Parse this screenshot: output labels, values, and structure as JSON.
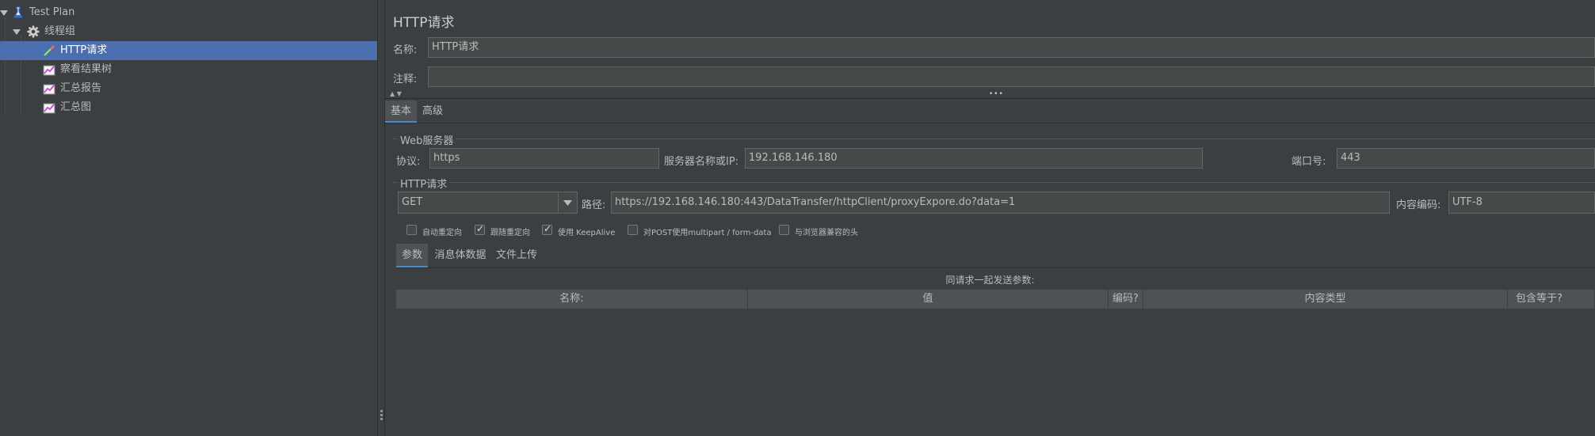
{
  "tree": {
    "items": [
      {
        "label": "Test Plan",
        "icon": "test-plan-icon"
      },
      {
        "label": "线程组",
        "icon": "gear-icon"
      },
      {
        "label": "HTTP请求",
        "icon": "sampler-pipette-icon"
      },
      {
        "label": "察看结果树",
        "icon": "listener-chart-icon"
      },
      {
        "label": "汇总报告",
        "icon": "listener-chart-icon"
      },
      {
        "label": "汇总图",
        "icon": "listener-chart-icon"
      }
    ]
  },
  "panel": {
    "title": "HTTP请求",
    "name_label": "名称:",
    "name_value": "HTTP请求",
    "comment_label": "注释:",
    "comment_value": "",
    "collapse_arrows": "▲ ▼",
    "divider_grip": "•••"
  },
  "tabs": {
    "basic": "基本",
    "advanced": "高级"
  },
  "web_server": {
    "section_title": "Web服务器",
    "protocol_label": "协议:",
    "protocol_value": "https",
    "server_label": "服务器名称或IP:",
    "server_value": "192.168.146.180",
    "port_label": "端口号:",
    "port_value": "443"
  },
  "http_request": {
    "section_title": "HTTP请求",
    "method": "GET",
    "path_label": "路径:",
    "path_value": "https://192.168.146.180:443/DataTransfer/httpClient/proxyExpore.do?data=1",
    "encoding_label": "内容编码:",
    "encoding_value": "UTF-8"
  },
  "options": [
    {
      "label": "自动重定向",
      "checked": false
    },
    {
      "label": "跟随重定向",
      "checked": true
    },
    {
      "label": "使用 KeepAlive",
      "checked": true
    },
    {
      "label": "对POST使用multipart / form-data",
      "checked": false
    },
    {
      "label": "与浏览器兼容的头",
      "checked": false
    }
  ],
  "subtabs": {
    "params": "参数",
    "body": "消息体数据",
    "files": "文件上传"
  },
  "params_table": {
    "caption": "同请求一起发送参数:",
    "columns": [
      "名称:",
      "值",
      "编码?",
      "内容类型",
      "包含等于?"
    ]
  },
  "colors": {
    "background": "#3c3f41",
    "selection": "#4b6eaf",
    "field": "#45494a",
    "accent": "#4a88c7"
  }
}
